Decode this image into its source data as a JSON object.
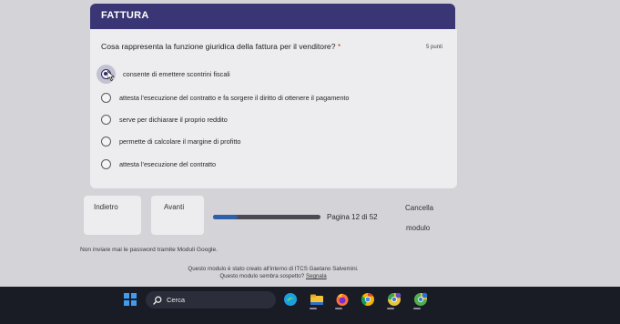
{
  "form": {
    "section_title": "FATTURA",
    "question": "Cosa rappresenta la funzione giuridica della fattura per il venditore?",
    "required_marker": "*",
    "points": "5 punti",
    "options": [
      {
        "label": "consente di emettere scontrini fiscali",
        "selected": true
      },
      {
        "label": "attesta l'esecuzione del contratto e fa sorgere il diritto di ottenere il pagamento",
        "selected": false
      },
      {
        "label": "serve per dichiarare il proprio reddito",
        "selected": false
      },
      {
        "label": "permette di calcolare il margine di profitto",
        "selected": false
      },
      {
        "label": "attesta l'esecuzione del contratto",
        "selected": false
      }
    ]
  },
  "navigation": {
    "back_label": "Indietro",
    "next_label": "Avanti",
    "cancel_label": "Cancella",
    "form_label": "modulo",
    "page_indicator": "Pagina 12 di 52",
    "progress": 0.23
  },
  "footer": {
    "password_warning": "Non inviare mai le password tramite Moduli Google.",
    "created_note": "Questo modulo è stato creato all'interno di ITCS Gaetano Salvemini.",
    "suspicious_text": "Questo modulo sembra sospetto?",
    "report_link": "Segnala"
  },
  "taskbar": {
    "search_label": "Cerca",
    "apps": [
      {
        "icon": "edge-icon",
        "color": "#1aa0e0"
      },
      {
        "icon": "file-explorer-icon",
        "color": "#f2c337"
      },
      {
        "icon": "firefox-icon",
        "color": "#ff7139"
      },
      {
        "icon": "chrome-icon",
        "color": "#f4b400"
      },
      {
        "icon": "chrome-profile-1-icon",
        "color": "#e8c637"
      },
      {
        "icon": "chrome-profile-2-icon",
        "color": "#4fae4a"
      }
    ]
  },
  "colors": {
    "header": "#3a3675",
    "card": "#ededf0",
    "background": "#d4d3d8",
    "progress_fill": "#2e5fa8",
    "taskbar": "#1a1c25"
  }
}
